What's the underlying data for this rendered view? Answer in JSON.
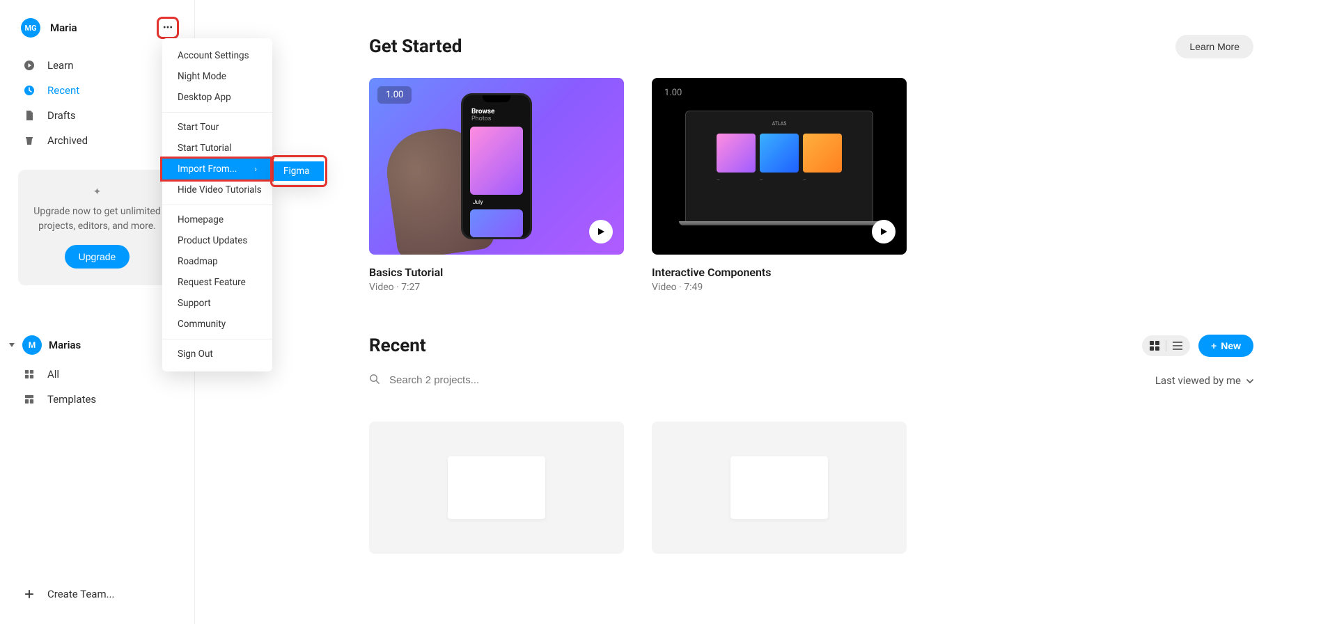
{
  "user": {
    "initials": "MG",
    "name": "Maria"
  },
  "nav": {
    "learn": "Learn",
    "recent": "Recent",
    "drafts": "Drafts",
    "archived": "Archived"
  },
  "upgrade": {
    "text": "Upgrade now to get unlimited projects, editors, and more.",
    "button": "Upgrade"
  },
  "team": {
    "initial": "M",
    "name": "Marias",
    "all": "All",
    "templates": "Templates"
  },
  "create_team": "Create Team...",
  "dropdown": {
    "account_settings": "Account Settings",
    "night_mode": "Night Mode",
    "desktop_app": "Desktop App",
    "start_tour": "Start Tour",
    "start_tutorial": "Start Tutorial",
    "import_from": "Import From...",
    "hide_video": "Hide Video Tutorials",
    "homepage": "Homepage",
    "product_updates": "Product Updates",
    "roadmap": "Roadmap",
    "request_feature": "Request Feature",
    "support": "Support",
    "community": "Community",
    "sign_out": "Sign Out",
    "submenu_figma": "Figma"
  },
  "get_started": {
    "title": "Get Started",
    "learn_more": "Learn More",
    "card1": {
      "badge": "1.00",
      "title": "Basics Tutorial",
      "meta": "Video · 7:27",
      "phone_browse": "Browse",
      "phone_photos": "Photos",
      "phone_month": "July"
    },
    "card2": {
      "badge": "1.00",
      "title": "Interactive Components",
      "meta": "Video · 7:49",
      "laptop_title": "ATLAS"
    }
  },
  "recent": {
    "title": "Recent",
    "new": "New",
    "search_placeholder": "Search 2 projects...",
    "sort": "Last viewed by me"
  }
}
